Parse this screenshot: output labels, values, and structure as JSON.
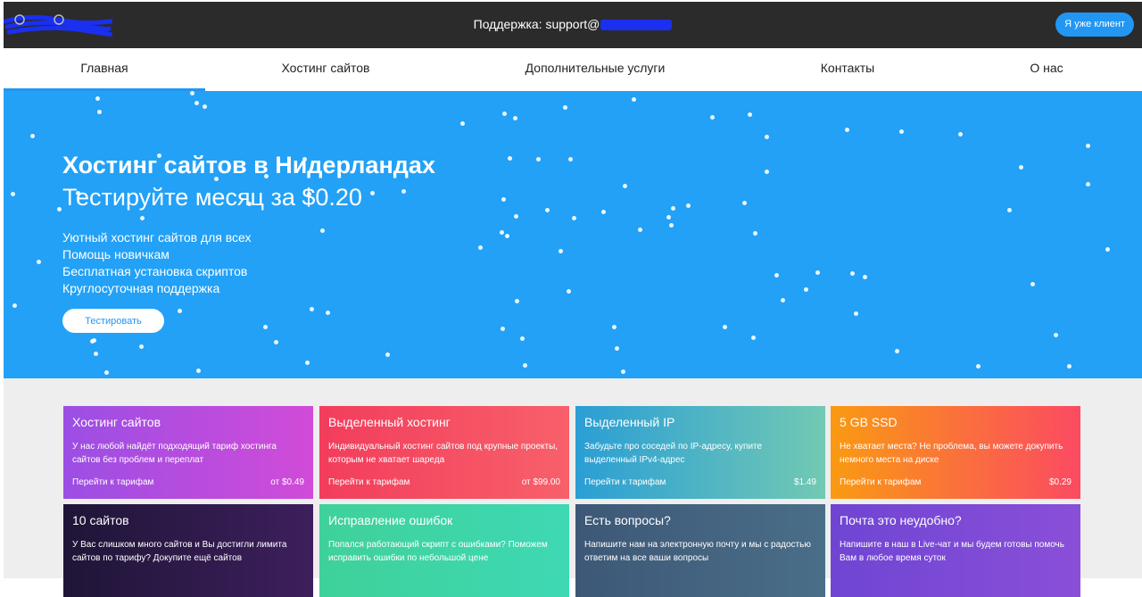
{
  "topbar": {
    "support_label": "Поддержка: support@",
    "client_button": "Я уже клиент"
  },
  "nav": {
    "items": [
      "Главная",
      "Хостинг сайтов",
      "Дополнительные услуги",
      "Контакты",
      "О нас"
    ],
    "active": 0
  },
  "hero": {
    "title": "Хостинг сайтов в Нидерландах",
    "subtitle": "Тестируйте месяц за $0.20",
    "features": [
      "Уютный хостинг сайтов для всех",
      "Помощь новичкам",
      "Бесплатная установка скриптов",
      "Круглосуточная поддержка"
    ],
    "cta": "Тестировать",
    "color": "#22a1f7"
  },
  "cards": [
    {
      "title": "Хостинг сайтов",
      "text": "У нас любой найдёт подходящий тариф хостинга сайтов без проблем и переплат",
      "link": "Перейти к тарифам",
      "price": "от $0.49",
      "gradient": [
        "#9b4ee4",
        "#d14bd8"
      ]
    },
    {
      "title": "Выделенный хостинг",
      "text": "Индивидуальный хостинг сайтов под крупные проекты, которым не хватает шареда",
      "link": "Перейти к тарифам",
      "price": "от $99.00",
      "gradient": [
        "#f23d5c",
        "#f8606a"
      ]
    },
    {
      "title": "Выделенный IP",
      "text": "Забудьте про соседей по IP-адресу, купите выделенный IPv4-адрес",
      "link": "Перейти к тарифам",
      "price": "$1.49",
      "gradient": [
        "#2a9ed5",
        "#72c9b3"
      ]
    },
    {
      "title": "5 GB SSD",
      "text": "Не хватает места? Не проблема, вы можете докупить немного места на диске",
      "link": "Перейти к тарифам",
      "price": "$0.29",
      "gradient": [
        "#fa9a12",
        "#fb4a62"
      ]
    },
    {
      "title": "10 сайтов",
      "text": "У Вас слишком много сайтов и Вы достигли лимита сайтов по тарифу? Докупите ещё сайтов",
      "link": "",
      "price": "",
      "gradient": [
        "#1f1537",
        "#3d1f5c"
      ]
    },
    {
      "title": "Исправление ошибок",
      "text": "Попался работающий скрипт с ошибками? Поможем исправить ошибки по небольшой цене",
      "link": "",
      "price": "",
      "gradient": [
        "#3fd19a",
        "#3ed8b3"
      ]
    },
    {
      "title": "Есть вопросы?",
      "text": "Напишите нам на электронную почту и мы с радостью ответим на все ваши вопросы",
      "link": "",
      "price": "",
      "gradient": [
        "#3d5877",
        "#4a6e88"
      ]
    },
    {
      "title": "Почта это неудобно?",
      "text": "Напишите в наш в Live-чат и мы будем готовы помочь Вам в любое время суток",
      "link": "",
      "price": "",
      "gradient": [
        "#6f45d3",
        "#8a4fd8"
      ]
    }
  ]
}
